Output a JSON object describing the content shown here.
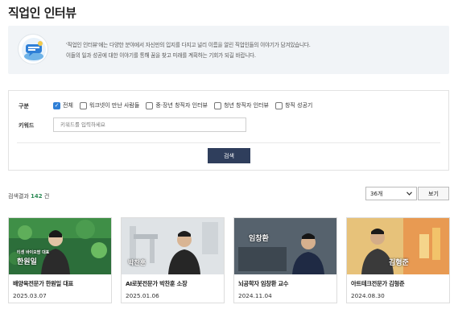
{
  "page": {
    "title": "직업인 인터뷰"
  },
  "intro": {
    "line1": "'직업인 인터뷰'에는 다양한 분야에서 자신만의 입지를 다지고 널리 이름을 알린 직업인들의 이야기가 담겨있습니다.",
    "line2": "이들의 일과 성공에 대한 이야기를 통해 꿈을 찾고 미래를 계획하는 기회가 되길 바랍니다."
  },
  "filters": {
    "category_label": "구분",
    "keyword_label": "키워드",
    "options": [
      {
        "label": "전체",
        "checked": true
      },
      {
        "label": "워크넷이 만난 사람들",
        "checked": false
      },
      {
        "label": "중·장년 창직자 인터뷰",
        "checked": false
      },
      {
        "label": "청년 창직자 인터뷰",
        "checked": false
      },
      {
        "label": "창직 성공기",
        "checked": false
      }
    ],
    "keyword_placeholder": "키워드를 입력하세요",
    "search_label": "검색"
  },
  "results": {
    "prefix": "검색결과",
    "count": "142",
    "suffix": "건",
    "per_page": "36개",
    "view_label": "보기"
  },
  "cards": [
    {
      "title": "배양육전문가 한원일 대표",
      "date": "2025.03.07",
      "caption_small": "티센 바이오팜 대표",
      "caption_big": "한원일"
    },
    {
      "title": "AI로봇전문가 박찬훈 소장",
      "date": "2025.01.06",
      "caption_small": "",
      "caption_big": "박찬훈"
    },
    {
      "title": "뇌공학자 임창환 교수",
      "date": "2024.11.04",
      "caption_small": "",
      "caption_big": "임창환"
    },
    {
      "title": "아트테크전문가 김형준",
      "date": "2024.08.30",
      "caption_small": "",
      "caption_big": "김형준"
    }
  ],
  "colors": {
    "accent": "#2f3e5c",
    "checkbox": "#2f7fd6",
    "count": "#2e8b57",
    "intro_bg": "#f1f4f7"
  }
}
